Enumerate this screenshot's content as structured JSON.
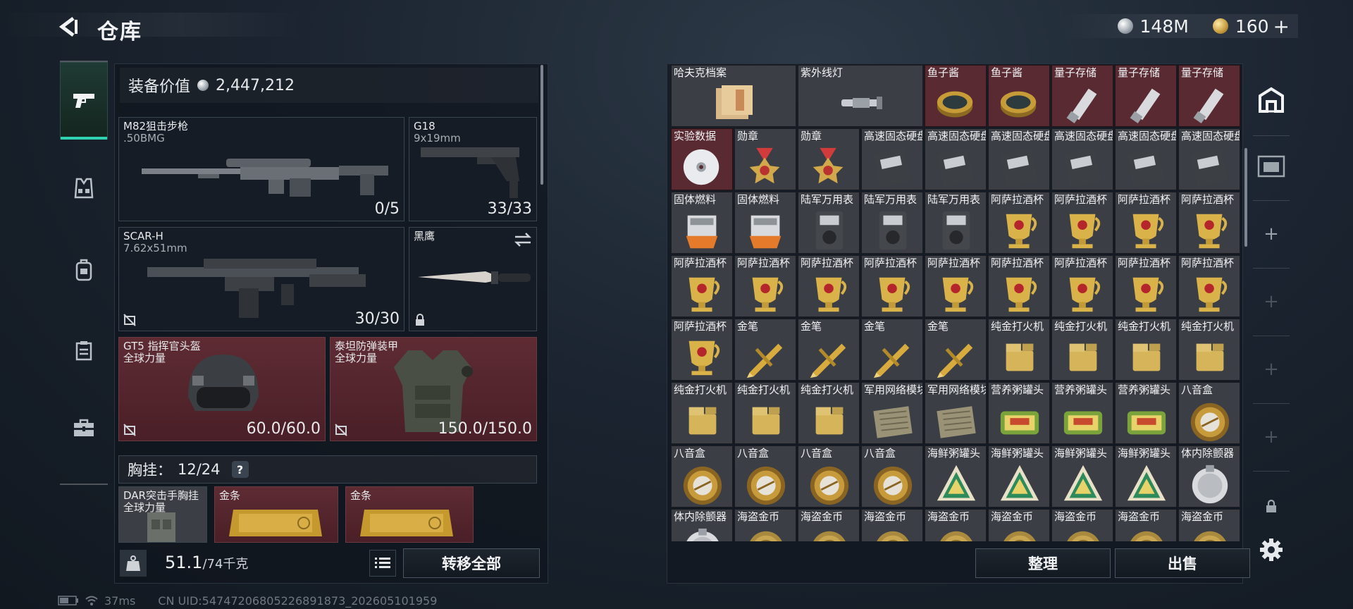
{
  "header": {
    "title": "仓库",
    "currency": [
      {
        "icon": "silver-coin-icon",
        "value": "148M"
      },
      {
        "icon": "gold-coin-icon",
        "value": "160"
      }
    ],
    "add_label": "+"
  },
  "loadout": {
    "equip_value_label": "装备价值",
    "equip_value": "2,447,212",
    "slots": {
      "primary": {
        "name": "M82狙击步枪",
        "ammo": ".50BMG",
        "count": "0/5"
      },
      "sidearm": {
        "name": "G18",
        "ammo": "9x19mm",
        "count": "33/33"
      },
      "secondary": {
        "name": "SCAR-H",
        "ammo": "7.62x51mm",
        "count": "30/30"
      },
      "melee": {
        "name": "黑鹰"
      },
      "helmet": {
        "name": "GT5 指挥官头盔",
        "brand": "全球力量",
        "durability": "60.0/60.0"
      },
      "armor": {
        "name": "泰坦防弹装甲",
        "brand": "全球力量",
        "durability": "150.0/150.0"
      }
    },
    "chest_rig": {
      "label": "胸挂：",
      "capacity": "12/24",
      "help": "?"
    },
    "rig_items": [
      {
        "name": "DAR突击手胸挂",
        "brand": "全球力量"
      },
      {
        "name": "金条"
      },
      {
        "name": "金条"
      }
    ],
    "weight": {
      "current": "51.1",
      "max": "/74千克"
    },
    "transfer_all": "转移全部"
  },
  "status": {
    "ping": "37ms",
    "uid": "CN UID:5474720680522689187​3_202605101959"
  },
  "stash": {
    "colors": {
      "normal": "#3b3f45",
      "rare": "#5a2a32"
    },
    "rows": [
      [
        {
          "name": "哈夫克档案",
          "kind": "docs",
          "rare": false
        },
        {
          "name": "紫外线灯",
          "kind": "uvlamp",
          "rare": false
        },
        {
          "name": "鱼子酱",
          "kind": "caviar",
          "rare": true
        },
        {
          "name": "鱼子酱",
          "kind": "caviar",
          "rare": true
        },
        {
          "name": "量子存储",
          "kind": "usb",
          "rare": true
        },
        {
          "name": "量子存储",
          "kind": "usb",
          "rare": true
        },
        {
          "name": "量子存储",
          "kind": "usb",
          "rare": true
        }
      ],
      [
        {
          "name": "实验数据",
          "kind": "disc",
          "rare": true
        },
        {
          "name": "勋章",
          "kind": "medal",
          "rare": false
        },
        {
          "name": "勋章",
          "kind": "medal",
          "rare": false
        },
        {
          "name": "高速固态硬盘",
          "kind": "ssd",
          "rare": false
        },
        {
          "name": "高速固态硬盘",
          "kind": "ssd",
          "rare": false
        },
        {
          "name": "高速固态硬盘",
          "kind": "ssd",
          "rare": false
        },
        {
          "name": "高速固态硬盘",
          "kind": "ssd",
          "rare": false
        },
        {
          "name": "高速固态硬盘",
          "kind": "ssd",
          "rare": false
        },
        {
          "name": "高速固态硬盘",
          "kind": "ssd",
          "rare": false
        }
      ],
      [
        {
          "name": "固体燃料",
          "kind": "fuel",
          "rare": false
        },
        {
          "name": "固体燃料",
          "kind": "fuel",
          "rare": false
        },
        {
          "name": "陆军万用表",
          "kind": "meter",
          "rare": false
        },
        {
          "name": "陆军万用表",
          "kind": "meter",
          "rare": false
        },
        {
          "name": "陆军万用表",
          "kind": "meter",
          "rare": false
        },
        {
          "name": "阿萨拉酒杯",
          "kind": "cup",
          "rare": false
        },
        {
          "name": "阿萨拉酒杯",
          "kind": "cup",
          "rare": false
        },
        {
          "name": "阿萨拉酒杯",
          "kind": "cup",
          "rare": false
        },
        {
          "name": "阿萨拉酒杯",
          "kind": "cup",
          "rare": false
        }
      ],
      [
        {
          "name": "阿萨拉酒杯",
          "kind": "cup",
          "rare": false
        },
        {
          "name": "阿萨拉酒杯",
          "kind": "cup",
          "rare": false
        },
        {
          "name": "阿萨拉酒杯",
          "kind": "cup",
          "rare": false
        },
        {
          "name": "阿萨拉酒杯",
          "kind": "cup",
          "rare": false
        },
        {
          "name": "阿萨拉酒杯",
          "kind": "cup",
          "rare": false
        },
        {
          "name": "阿萨拉酒杯",
          "kind": "cup",
          "rare": false
        },
        {
          "name": "阿萨拉酒杯",
          "kind": "cup",
          "rare": false
        },
        {
          "name": "阿萨拉酒杯",
          "kind": "cup",
          "rare": false
        },
        {
          "name": "阿萨拉酒杯",
          "kind": "cup",
          "rare": false
        }
      ],
      [
        {
          "name": "阿萨拉酒杯",
          "kind": "cup",
          "rare": false
        },
        {
          "name": "金笔",
          "kind": "pen",
          "rare": false
        },
        {
          "name": "金笔",
          "kind": "pen",
          "rare": false
        },
        {
          "name": "金笔",
          "kind": "pen",
          "rare": false
        },
        {
          "name": "金笔",
          "kind": "pen",
          "rare": false
        },
        {
          "name": "纯金打火机",
          "kind": "lighter",
          "rare": false
        },
        {
          "name": "纯金打火机",
          "kind": "lighter",
          "rare": false
        },
        {
          "name": "纯金打火机",
          "kind": "lighter",
          "rare": false
        },
        {
          "name": "纯金打火机",
          "kind": "lighter",
          "rare": false
        }
      ],
      [
        {
          "name": "纯金打火机",
          "kind": "lighter",
          "rare": false
        },
        {
          "name": "纯金打火机",
          "kind": "lighter",
          "rare": false
        },
        {
          "name": "纯金打火机",
          "kind": "lighter",
          "rare": false
        },
        {
          "name": "军用网络模块",
          "kind": "module",
          "rare": false
        },
        {
          "name": "军用网络模块",
          "kind": "module",
          "rare": false
        },
        {
          "name": "营养粥罐头",
          "kind": "tin",
          "rare": false
        },
        {
          "name": "营养粥罐头",
          "kind": "tin",
          "rare": false
        },
        {
          "name": "营养粥罐头",
          "kind": "tin",
          "rare": false
        },
        {
          "name": "八音盒",
          "kind": "musicbox",
          "rare": false
        }
      ],
      [
        {
          "name": "八音盒",
          "kind": "musicbox",
          "rare": false
        },
        {
          "name": "八音盒",
          "kind": "musicbox",
          "rare": false
        },
        {
          "name": "八音盒",
          "kind": "musicbox",
          "rare": false
        },
        {
          "name": "八音盒",
          "kind": "musicbox",
          "rare": false
        },
        {
          "name": "海鲜粥罐头",
          "kind": "seafood",
          "rare": false
        },
        {
          "name": "海鲜粥罐头",
          "kind": "seafood",
          "rare": false
        },
        {
          "name": "海鲜粥罐头",
          "kind": "seafood",
          "rare": false
        },
        {
          "name": "海鲜粥罐头",
          "kind": "seafood",
          "rare": false
        },
        {
          "name": "体内除颤器",
          "kind": "defib",
          "rare": false
        }
      ],
      [
        {
          "name": "体内除颤器",
          "kind": "defib",
          "rare": false
        },
        {
          "name": "海盗金币",
          "kind": "coin",
          "rare": false
        },
        {
          "name": "海盗金币",
          "kind": "coin",
          "rare": false
        },
        {
          "name": "海盗金币",
          "kind": "coin",
          "rare": false
        },
        {
          "name": "海盗金币",
          "kind": "coin",
          "rare": false
        },
        {
          "name": "海盗金币",
          "kind": "coin",
          "rare": false
        },
        {
          "name": "海盗金币",
          "kind": "coin",
          "rare": false
        },
        {
          "name": "海盗金币",
          "kind": "coin",
          "rare": false
        },
        {
          "name": "海盗金币",
          "kind": "coin",
          "rare": false
        }
      ]
    ],
    "sort_label": "整理",
    "sell_label": "出售"
  },
  "right_tabs": [
    {
      "icon": "stash-home-icon"
    },
    {
      "icon": "vault-card-icon"
    },
    {
      "icon": "add-icon",
      "label": "+"
    },
    {
      "icon": "add-icon",
      "label": "+"
    },
    {
      "icon": "add-icon",
      "label": "+"
    },
    {
      "icon": "add-icon",
      "label": "+"
    },
    {
      "icon": "lock-icon"
    }
  ]
}
